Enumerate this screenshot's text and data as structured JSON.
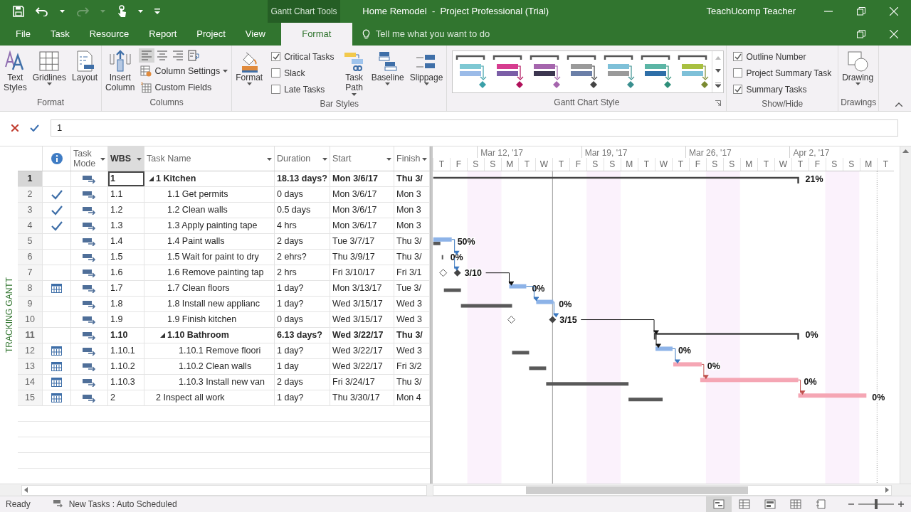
{
  "title_bar": {
    "contextual_group": "Gantt Chart Tools",
    "title": "Home Remodel  -  Project Professional (Trial)",
    "user": "TeachUcomp Teacher"
  },
  "ribbon_tabs": [
    {
      "label": "File",
      "selected": false
    },
    {
      "label": "Task",
      "selected": false
    },
    {
      "label": "Resource",
      "selected": false
    },
    {
      "label": "Report",
      "selected": false
    },
    {
      "label": "Project",
      "selected": false
    },
    {
      "label": "View",
      "selected": false
    },
    {
      "label": "Format",
      "selected": true
    }
  ],
  "tell_me": {
    "placeholder": "Tell me what you want to do"
  },
  "ribbon_groups": [
    {
      "label": "Format",
      "buttons": [
        {
          "kind": "styles",
          "label": "Text Styles",
          "dropdown": false
        },
        {
          "kind": "grid",
          "label": "Gridlines",
          "dropdown": true
        },
        {
          "kind": "layout",
          "label": "Layout",
          "dropdown": false
        }
      ]
    },
    {
      "label": "Columns",
      "buttons": [
        {
          "kind": "insert",
          "label": "Insert Column",
          "dropdown": false
        }
      ],
      "align_buttons": [
        {
          "kind": "left",
          "selected": true
        },
        {
          "kind": "center",
          "selected": false
        },
        {
          "kind": "right",
          "selected": false
        },
        {
          "kind": "wrap",
          "selected": false
        }
      ],
      "small_buttons": [
        {
          "kind": "settings",
          "label": "Column Settings",
          "dropdown": true
        },
        {
          "kind": "fields",
          "label": "Custom Fields",
          "dropdown": false
        }
      ]
    },
    {
      "label": "Bar Styles",
      "buttons": [
        {
          "kind": "format",
          "label": "Format",
          "dropdown": true
        }
      ],
      "checkboxes": [
        {
          "label": "Critical Tasks",
          "checked": true
        },
        {
          "label": "Slack",
          "checked": false
        },
        {
          "label": "Late Tasks",
          "checked": false
        }
      ],
      "buttons_2": [
        {
          "kind": "path",
          "label": "Task Path",
          "dropdown": true
        },
        {
          "kind": "baseline",
          "label": "Baseline",
          "dropdown": true
        },
        {
          "kind": "slippage",
          "label": "Slippage",
          "dropdown": true
        }
      ]
    },
    {
      "label": "Gantt Chart Style",
      "styles": [
        {
          "color": "#7ec8d3"
        },
        {
          "color": "#d63c8f"
        },
        {
          "color": "#a565ad"
        },
        {
          "color": "#9a9a9a"
        },
        {
          "color": "#7ec0d8"
        },
        {
          "color": "#5bb5a5"
        },
        {
          "color": "#a8c040"
        }
      ]
    },
    {
      "label": "Show/Hide",
      "checkboxes": [
        {
          "label": "Outline Number",
          "checked": true
        },
        {
          "label": "Project Summary Task",
          "checked": false
        },
        {
          "label": "Summary Tasks",
          "checked": true
        }
      ]
    },
    {
      "label": "Drawings",
      "buttons": [
        {
          "kind": "drawing",
          "label": "Drawing",
          "dropdown": true
        }
      ]
    }
  ],
  "entry_bar": {
    "value": "1"
  },
  "view_label": "TRACKING GANTT",
  "table": {
    "columns": [
      {
        "kind": "info",
        "selected": false
      },
      {
        "label": "Task Mode",
        "kind": "text",
        "selected": false
      },
      {
        "label": "WBS",
        "kind": "text",
        "selected": true
      },
      {
        "label": "Task Name",
        "kind": "text",
        "selected": false
      },
      {
        "label": "Duration",
        "kind": "text",
        "selected": false
      },
      {
        "label": "Start",
        "kind": "text",
        "selected": false
      },
      {
        "label": "Finish",
        "kind": "text",
        "selected": false
      }
    ],
    "tasks": [
      {
        "row": "1",
        "kind": "none",
        "wbs": "1",
        "name": "1 Kitchen",
        "duration": "18.13 days?",
        "start": "Mon 3/6/17",
        "finish": "Thu 3/",
        "summary": true,
        "expanded": true,
        "selected": true,
        "bar_label": "21%",
        "children": [
          {
            "row": "2",
            "kind": "complete",
            "wbs": "1.1",
            "name": "1.1 Get permits",
            "duration": "0 days",
            "start": "Mon 3/6/17",
            "finish": "Mon 3",
            "summary": false,
            "selected": false
          },
          {
            "row": "3",
            "kind": "complete",
            "wbs": "1.2",
            "name": "1.2 Clean walls",
            "duration": "0.5 days",
            "start": "Mon 3/6/17",
            "finish": "Mon 3",
            "summary": false,
            "selected": false
          },
          {
            "row": "4",
            "kind": "complete",
            "wbs": "1.3",
            "name": "1.3 Apply painting tape",
            "duration": "4 hrs",
            "start": "Mon 3/6/17",
            "finish": "Mon 3",
            "summary": false,
            "selected": false
          },
          {
            "row": "5",
            "kind": "none",
            "wbs": "1.4",
            "name": "1.4 Paint walls",
            "duration": "2 days",
            "start": "Tue 3/7/17",
            "finish": "Thu 3/",
            "summary": false,
            "critical": false,
            "selected": false,
            "bar_label": "50%"
          },
          {
            "row": "6",
            "kind": "none",
            "wbs": "1.5",
            "name": "1.5 Wait for paint to dry",
            "duration": "2 ehrs?",
            "start": "Thu 3/9/17",
            "finish": "Thu 3/",
            "summary": false,
            "selected": false,
            "bar_label": "0%"
          },
          {
            "row": "7",
            "kind": "none",
            "wbs": "1.6",
            "name": "1.6 Remove painting tap",
            "duration": "2 hrs",
            "start": "Fri 3/10/17",
            "finish": "Fri 3/1",
            "summary": false,
            "selected": false,
            "bar_label": "3/10"
          },
          {
            "row": "8",
            "kind": "constraint",
            "wbs": "1.7",
            "name": "1.7 Clean floors",
            "duration": "1 day?",
            "start": "Mon 3/13/17",
            "finish": "Tue 3/",
            "summary": false,
            "critical": false,
            "selected": false,
            "bar_label": "0%"
          },
          {
            "row": "9",
            "kind": "none",
            "wbs": "1.8",
            "name": "1.8 Install new applianc",
            "duration": "1 day?",
            "start": "Wed 3/15/17",
            "finish": "Wed 3",
            "summary": false,
            "critical": false,
            "selected": false,
            "bar_label": "0%"
          },
          {
            "row": "10",
            "kind": "none",
            "wbs": "1.9",
            "name": "1.9 Finish kitchen",
            "duration": "0 days",
            "start": "Wed 3/15/17",
            "finish": "Wed 3",
            "summary": false,
            "selected": false,
            "bar_label": "3/15"
          },
          {
            "row": "11",
            "kind": "none",
            "wbs": "1.10",
            "name": "1.10 Bathroom",
            "duration": "6.13 days?",
            "start": "Wed 3/22/17",
            "finish": "Thu 3/",
            "summary": true,
            "expanded": true,
            "selected": false,
            "bar_label": "0%",
            "children": [
              {
                "row": "12",
                "kind": "constraint",
                "wbs": "1.10.1",
                "name": "1.10.1 Remove floori",
                "duration": "1 day?",
                "start": "Wed 3/22/17",
                "finish": "Wed 3",
                "summary": false,
                "critical": false,
                "selected": false,
                "bar_label": "0%"
              },
              {
                "row": "13",
                "kind": "constraint",
                "wbs": "1.10.2",
                "name": "1.10.2 Clean walls",
                "duration": "1 day",
                "start": "Wed 3/22/17",
                "finish": "Fri 3/2",
                "summary": false,
                "critical": true,
                "selected": false,
                "bar_label": "0%"
              },
              {
                "row": "14",
                "kind": "constraint",
                "wbs": "1.10.3",
                "name": "1.10.3 Install new van",
                "duration": "2 days",
                "start": "Fri 3/24/17",
                "finish": "Thu 3/",
                "summary": false,
                "critical": true,
                "selected": false,
                "bar_label": "0%"
              }
            ]
          }
        ]
      },
      {
        "row": "15",
        "kind": "constraint",
        "wbs": "2",
        "name": "2 Inspect all work",
        "duration": "1 day?",
        "start": "Thu 3/30/17",
        "finish": "Mon 4",
        "summary": false,
        "critical": true,
        "selected": false,
        "bar_label": "0%"
      }
    ]
  },
  "timescale": {
    "weeks": [
      "Mar 12, '17",
      "Mar 19, '17",
      "Mar 26, '17",
      "Apr 2, '17"
    ],
    "days": [
      "T",
      "F",
      "S",
      "S",
      "M",
      "T",
      "W",
      "T",
      "F",
      "S",
      "S",
      "M",
      "T",
      "W",
      "T",
      "F",
      "S",
      "S",
      "M",
      "T",
      "W",
      "T",
      "F",
      "S",
      "S",
      "M",
      "T"
    ]
  },
  "status_bar": {
    "state": "Ready",
    "new_tasks": "New Tasks : Auto Scheduled",
    "views": [
      {
        "kind": "gantt",
        "selected": true
      },
      {
        "kind": "usage",
        "selected": false
      },
      {
        "kind": "planner",
        "selected": false
      },
      {
        "kind": "sheet",
        "selected": false
      },
      {
        "kind": "report",
        "selected": false
      }
    ],
    "zoom": {
      "level": 0.5
    }
  }
}
